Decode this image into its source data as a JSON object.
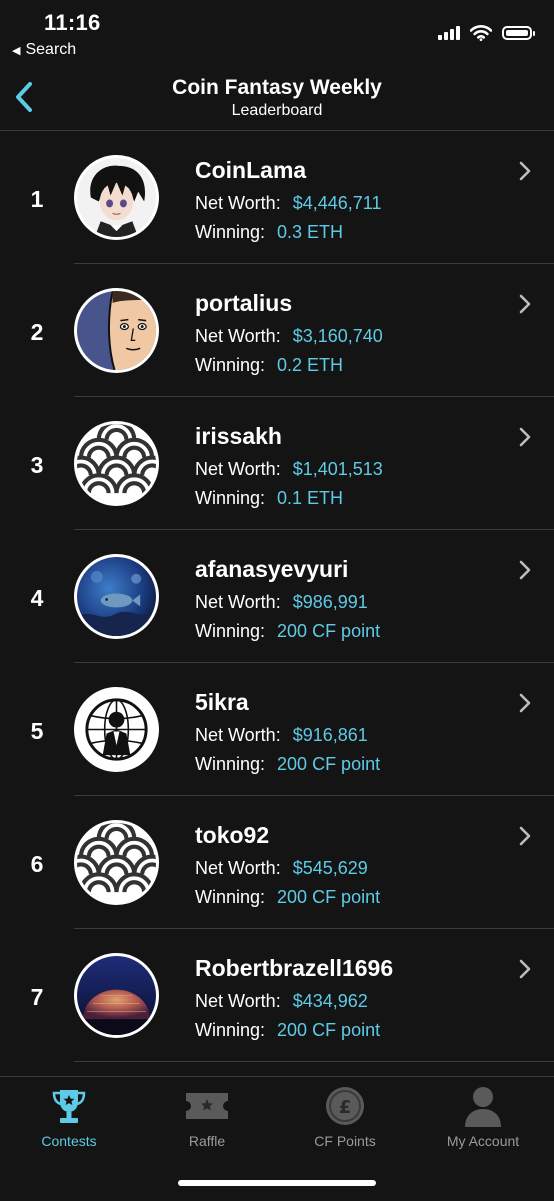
{
  "status_bar": {
    "time": "11:16",
    "back_label": "Search"
  },
  "header": {
    "title": "Coin Fantasy Weekly",
    "subtitle": "Leaderboard"
  },
  "labels": {
    "net_worth": "Net Worth:",
    "winning": "Winning:"
  },
  "colors": {
    "accent": "#5ecbe6",
    "background": "#141414",
    "inactive": "#9a9a9a"
  },
  "entries": [
    {
      "rank": "1",
      "username": "CoinLama",
      "net_worth": "$4,446,711",
      "winning": "0.3 ETH",
      "avatar": "anime-character-avatar"
    },
    {
      "rank": "2",
      "username": "portalius",
      "net_worth": "$3,160,740",
      "winning": "0.2 ETH",
      "avatar": "cartoon-face-avatar"
    },
    {
      "rank": "3",
      "username": "irissakh",
      "net_worth": "$1,401,513",
      "winning": "0.1 ETH",
      "avatar": "wave-pattern-avatar"
    },
    {
      "rank": "4",
      "username": "afanasyevyuri",
      "net_worth": "$986,991",
      "winning": "200 CF point",
      "avatar": "aquarium-fish-avatar"
    },
    {
      "rank": "5",
      "username": "5ikra",
      "net_worth": "$916,861",
      "winning": "200 CF point",
      "avatar": "anonymous-emblem-avatar"
    },
    {
      "rank": "6",
      "username": "toko92",
      "net_worth": "$545,629",
      "winning": "200 CF point",
      "avatar": "wave-pattern-avatar"
    },
    {
      "rank": "7",
      "username": "Robertbrazell1696",
      "net_worth": "$434,962",
      "winning": "200 CF point",
      "avatar": "night-dome-avatar"
    }
  ],
  "tabs": [
    {
      "label": "Contests",
      "icon": "trophy-icon",
      "active": true
    },
    {
      "label": "Raffle",
      "icon": "ticket-icon",
      "active": false
    },
    {
      "label": "CF Points",
      "icon": "coin-icon",
      "active": false
    },
    {
      "label": "My Account",
      "icon": "person-icon",
      "active": false
    }
  ]
}
